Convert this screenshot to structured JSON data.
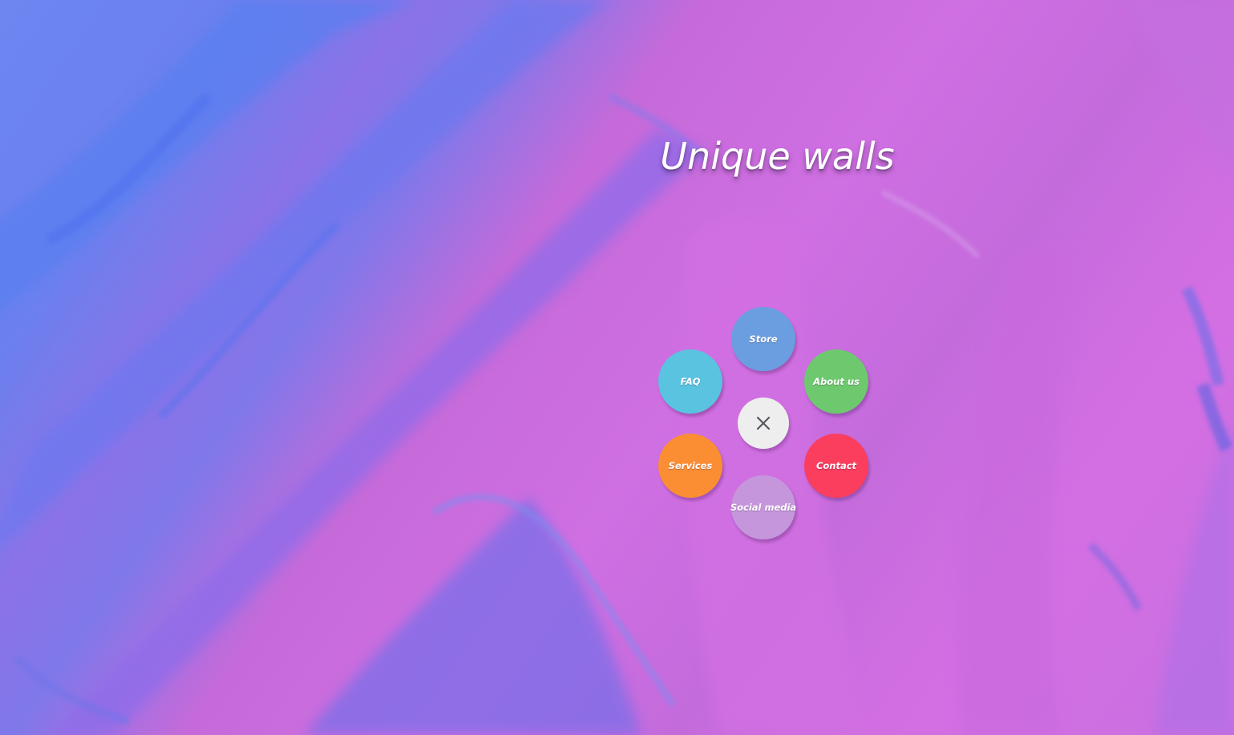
{
  "page": {
    "title": "Unique walls"
  },
  "menu": {
    "items": [
      {
        "label": "Store",
        "color": "#6a9ee0"
      },
      {
        "label": "FAQ",
        "color": "#5ac3e0"
      },
      {
        "label": "About us",
        "color": "#6ec96e"
      },
      {
        "label": "Services",
        "color": "#fb8e33"
      },
      {
        "label": "Contact",
        "color": "#fb3d5e"
      },
      {
        "label": "Social media",
        "color": "#c696dc"
      }
    ],
    "close_icon": "close-icon",
    "close_color": "#eeeeee"
  },
  "colors": {
    "background_blue": "#6d86f0",
    "background_pink": "#cf6fe2",
    "title_text": "#ffffff"
  }
}
